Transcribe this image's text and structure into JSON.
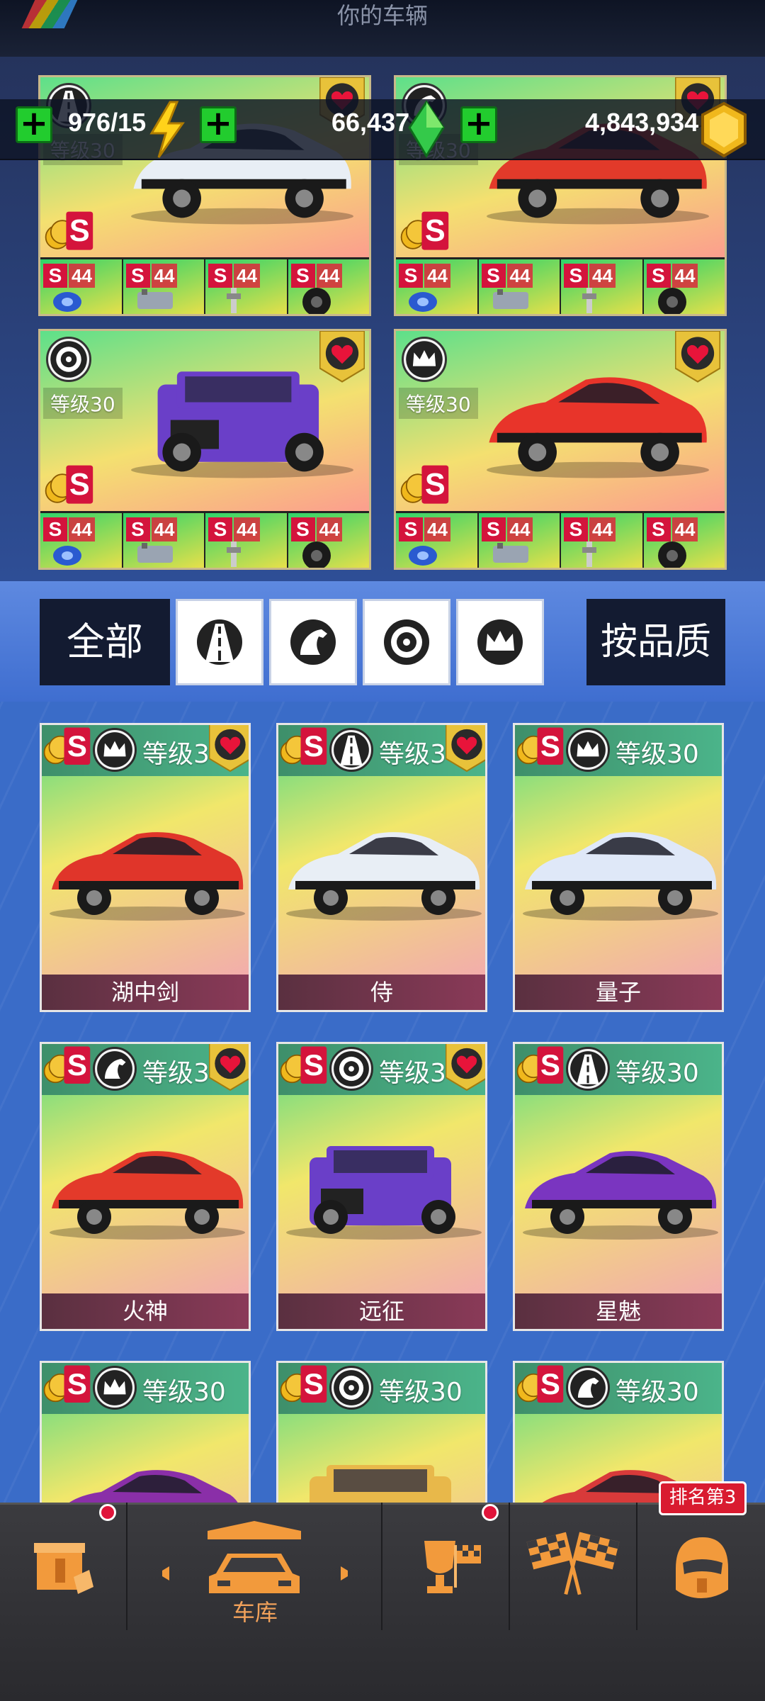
{
  "header": {
    "title": "你的车辆"
  },
  "resources": {
    "energy": {
      "value": "976/15",
      "icon": "lightning-bolt-icon"
    },
    "gems": {
      "value": "66,437",
      "icon": "green-gem-icon"
    },
    "coins": {
      "value": "4,843,934",
      "icon": "gold-coin-icon"
    },
    "plus_label": "+"
  },
  "featured_cars": [
    {
      "level": "等级30",
      "class_icon": "road-icon",
      "rank": "S",
      "favorite": true,
      "color": "#e8eef5",
      "parts": [
        {
          "badge": "S",
          "level": "44"
        },
        {
          "badge": "S",
          "level": "44"
        },
        {
          "badge": "S",
          "level": "44"
        },
        {
          "badge": "S",
          "level": "44"
        }
      ]
    },
    {
      "level": "等级30",
      "class_icon": "horse-icon",
      "rank": "S",
      "favorite": true,
      "color": "#e23a2a",
      "parts": [
        {
          "badge": "S",
          "level": "44"
        },
        {
          "badge": "S",
          "level": "44"
        },
        {
          "badge": "S",
          "level": "44"
        },
        {
          "badge": "S",
          "level": "44"
        }
      ]
    },
    {
      "level": "等级30",
      "class_icon": "wheel-icon",
      "rank": "S",
      "favorite": true,
      "color": "#6a3fc8",
      "parts": [
        {
          "badge": "S",
          "level": "44"
        },
        {
          "badge": "S",
          "level": "44"
        },
        {
          "badge": "S",
          "level": "44"
        },
        {
          "badge": "S",
          "level": "44"
        }
      ]
    },
    {
      "level": "等级30",
      "class_icon": "crown-icon",
      "rank": "S",
      "favorite": true,
      "color": "#e8342a",
      "parts": [
        {
          "badge": "S",
          "level": "44"
        },
        {
          "badge": "S",
          "level": "44"
        },
        {
          "badge": "S",
          "level": "44"
        },
        {
          "badge": "S",
          "level": "44"
        }
      ]
    }
  ],
  "filters": {
    "all_label": "全部",
    "quality_label": "按品质",
    "tabs": [
      "road-icon",
      "horse-icon",
      "wheel-icon",
      "crown-icon"
    ]
  },
  "cars": [
    {
      "name": "湖中剑",
      "level": "等级3",
      "class_icon": "crown-icon",
      "favorite": true,
      "color": "#e0352a"
    },
    {
      "name": "侍",
      "level": "等级3",
      "class_icon": "road-icon",
      "favorite": true,
      "color": "#e8eef5"
    },
    {
      "name": "量子",
      "level": "等级30",
      "class_icon": "crown-icon",
      "favorite": false,
      "color": "#dfe8f8"
    },
    {
      "name": "火神",
      "level": "等级3",
      "class_icon": "horse-icon",
      "favorite": true,
      "color": "#e33a2a"
    },
    {
      "name": "远征",
      "level": "等级3",
      "class_icon": "wheel-icon",
      "favorite": true,
      "color": "#6a3fc8"
    },
    {
      "name": "星魅",
      "level": "等级30",
      "class_icon": "road-icon",
      "favorite": false,
      "color": "#7a35c0"
    },
    {
      "name": "",
      "level": "等级30",
      "class_icon": "crown-icon",
      "favorite": false,
      "color": "#8a2fa8"
    },
    {
      "name": "",
      "level": "等级30",
      "class_icon": "wheel-icon",
      "favorite": false,
      "color": "#e8b84a"
    },
    {
      "name": "",
      "level": "等级30",
      "class_icon": "horse-icon",
      "favorite": false,
      "color": "#d83a3a"
    }
  ],
  "bottom_nav": {
    "garage_label": "车库",
    "rank_tag": "排名第3",
    "items": [
      "shop-icon",
      "garage-car-icon",
      "trophy-icon",
      "checkered-flags-icon",
      "helmet-icon"
    ]
  }
}
